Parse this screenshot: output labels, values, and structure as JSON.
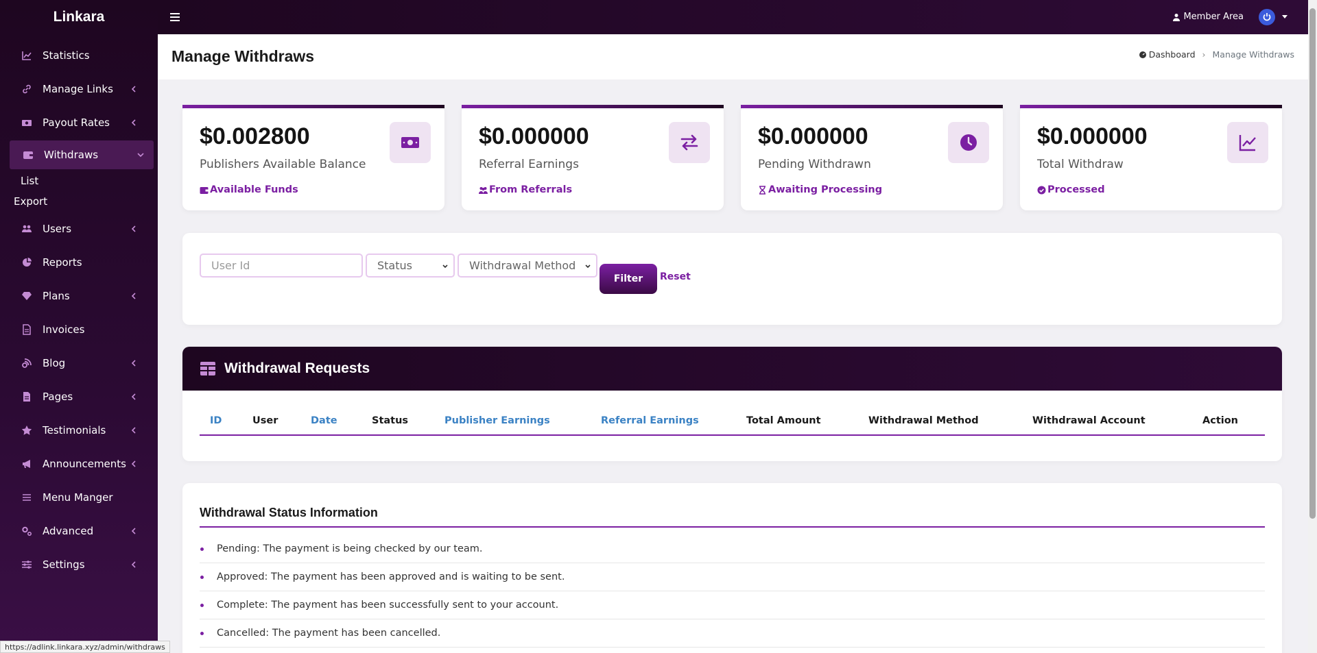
{
  "app": {
    "brand": "Linkara"
  },
  "sidebar": {
    "items": [
      {
        "label": "Statistics",
        "icon": "chart-line-icon",
        "chevron": false
      },
      {
        "label": "Manage Links",
        "icon": "link-icon",
        "chevron": true
      },
      {
        "label": "Payout Rates",
        "icon": "money-icon",
        "chevron": true
      },
      {
        "label": "Withdraws",
        "icon": "wallet-icon",
        "chevron": true,
        "active": true
      },
      {
        "label": "Users",
        "icon": "users-icon",
        "chevron": true
      },
      {
        "label": "Reports",
        "icon": "pie-chart-icon",
        "chevron": false
      },
      {
        "label": "Plans",
        "icon": "gem-icon",
        "chevron": true
      },
      {
        "label": "Invoices",
        "icon": "file-icon",
        "chevron": false
      },
      {
        "label": "Blog",
        "icon": "blog-icon",
        "chevron": true
      },
      {
        "label": "Pages",
        "icon": "page-icon",
        "chevron": true
      },
      {
        "label": "Testimonials",
        "icon": "star-icon",
        "chevron": true
      },
      {
        "label": "Announcements",
        "icon": "bullhorn-icon",
        "chevron": true
      },
      {
        "label": "Menu Manger",
        "icon": "list-icon",
        "chevron": false
      },
      {
        "label": "Advanced",
        "icon": "cogs-icon",
        "chevron": true
      },
      {
        "label": "Settings",
        "icon": "sliders-icon",
        "chevron": true
      }
    ],
    "sub_items": [
      "List",
      "Export"
    ]
  },
  "topbar": {
    "member_label": "Member Area"
  },
  "header": {
    "title": "Manage Withdraws",
    "breadcrumb": {
      "home": "Dashboard",
      "current": "Manage Withdraws"
    }
  },
  "cards": [
    {
      "value": "$0.002800",
      "label": "Publishers Available Balance",
      "sub": "Available Funds",
      "icon": "money-bill-icon"
    },
    {
      "value": "$0.000000",
      "label": "Referral Earnings",
      "sub": "From Referrals",
      "icon": "exchange-icon"
    },
    {
      "value": "$0.000000",
      "label": "Pending Withdrawn",
      "sub": "Awaiting Processing",
      "icon": "clock-icon"
    },
    {
      "value": "$0.000000",
      "label": "Total Withdraw",
      "sub": "Processed",
      "icon": "chart-line-icon"
    }
  ],
  "filter": {
    "user_id_placeholder": "User Id",
    "status_selected": "Status",
    "method_selected": "Withdrawal Method",
    "filter_label": "Filter",
    "reset_label": "Reset"
  },
  "table": {
    "title": "Withdrawal Requests",
    "columns": [
      "ID",
      "User",
      "Date",
      "Status",
      "Publisher Earnings",
      "Referral Earnings",
      "Total Amount",
      "Withdrawal Method",
      "Withdrawal Account",
      "Action"
    ],
    "rows": []
  },
  "info": {
    "title": "Withdrawal Status Information",
    "items": [
      "Pending: The payment is being checked by our team.",
      "Approved: The payment has been approved and is waiting to be sent.",
      "Complete: The payment has been successfully sent to your account.",
      "Cancelled: The payment has been cancelled."
    ]
  },
  "status_url": "https://adlink.linkara.xyz/admin/withdraws",
  "colors": {
    "accent": "#7b1fa2",
    "dark": "#1e0620",
    "link": "#3b82c4"
  }
}
